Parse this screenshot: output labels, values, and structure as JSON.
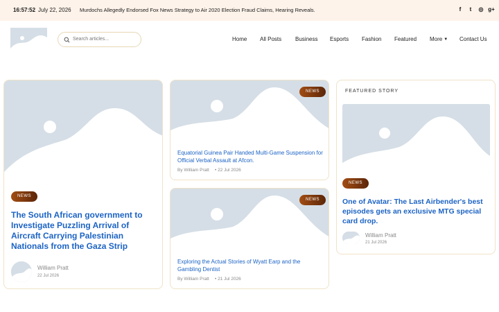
{
  "topbar": {
    "time": "16:57:52",
    "date": "July 22, 2026",
    "ticker": "Murdochs Allegedly Endorsed Fox News Strategy to Air 2020 Election Fraud Claims, Hearing Reveals."
  },
  "social": [
    {
      "icon": "facebook-icon",
      "glyph": "f"
    },
    {
      "icon": "twitter-icon",
      "glyph": "t"
    },
    {
      "icon": "instagram-icon",
      "glyph": "◎"
    },
    {
      "icon": "google-plus-icon",
      "glyph": "g+"
    }
  ],
  "search": {
    "placeholder": "Search articles..."
  },
  "nav": {
    "home": "Home",
    "all_posts": "All Posts",
    "business": "Business",
    "esports": "Esports",
    "fashion": "Fashion",
    "featured": "Featured",
    "more": "More",
    "contact": "Contact Us"
  },
  "colors": {
    "accent": "#1c63c4",
    "badge": "#8a3c0f",
    "topbar": "#fdf3ea",
    "placeholder": "#d5dee6"
  },
  "main_story": {
    "badge": "NEWS",
    "title": "The South African government to Investigate Puzzling Arrival of Aircraft Carrying Palestinian Nationals from the Gaza Strip",
    "author": "William Pratt",
    "date": "22 Jul 2026"
  },
  "middle_stories": [
    {
      "badge": "NEWS",
      "title": "Equatorial Guinea Pair Handed Multi-Game Suspension for Official Verbal Assault at Afcon.",
      "byline": "By William Pratt",
      "date": "• 22 Jul 2026"
    },
    {
      "badge": "NEWS",
      "title": "Exploring the Actual Stories of Wyatt Earp and the Gambling Dentist",
      "byline": "By William Pratt",
      "date": "• 21 Jul 2026"
    }
  ],
  "featured": {
    "label": "FEATURED STORY",
    "badge": "NEWS",
    "title": "One of Avatar: The Last Airbender's best episodes gets an exclusive MTG special card drop.",
    "author": "William Pratt",
    "date": "21 Jul 2026"
  }
}
